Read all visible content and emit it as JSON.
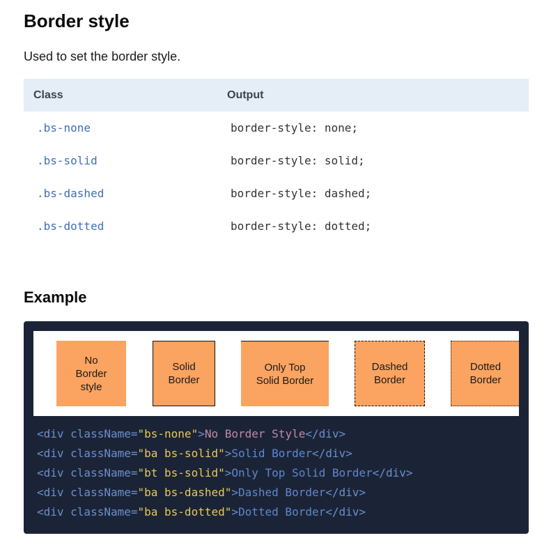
{
  "heading": "Border style",
  "description": "Used to set the border style.",
  "table": {
    "headers": {
      "class": "Class",
      "output": "Output"
    },
    "rows": [
      {
        "class": ".bs-none",
        "output": "border-style: none;"
      },
      {
        "class": ".bs-solid",
        "output": "border-style: solid;"
      },
      {
        "class": ".bs-dashed",
        "output": "border-style: dashed;"
      },
      {
        "class": ".bs-dotted",
        "output": "border-style: dotted;"
      }
    ]
  },
  "example": {
    "title": "Example",
    "preview": {
      "box_color": "#fba360",
      "boxes": [
        {
          "label_lines": [
            "No",
            "Border",
            "style"
          ]
        },
        {
          "label_lines": [
            "Solid",
            "Border"
          ]
        },
        {
          "label_lines": [
            "Only Top",
            "Solid Border"
          ]
        },
        {
          "label_lines": [
            "Dashed",
            "Border"
          ]
        },
        {
          "label_lines": [
            "Dotted",
            "Border"
          ]
        }
      ]
    },
    "code": {
      "background": "#1b2436",
      "lines": [
        {
          "open": "<div className=",
          "attr": "\"bs-none\"",
          "close": ">",
          "text": "No Border Style",
          "end": "</div>"
        },
        {
          "open": "<div className=",
          "attr": "\"ba bs-solid\"",
          "close": ">",
          "text": "Solid Border",
          "end": "</div>"
        },
        {
          "open": "<div className=",
          "attr": "\"bt bs-solid\"",
          "close": ">",
          "text": "Only Top Solid Border",
          "end": "</div>"
        },
        {
          "open": "<div className=",
          "attr": "\"ba bs-dashed\"",
          "close": ">",
          "text": "Dashed Border",
          "end": "</div>"
        },
        {
          "open": "<div className=",
          "attr": "\"ba bs-dotted\"",
          "close": ">",
          "text": "Dotted Border",
          "end": "</div>"
        }
      ]
    }
  }
}
